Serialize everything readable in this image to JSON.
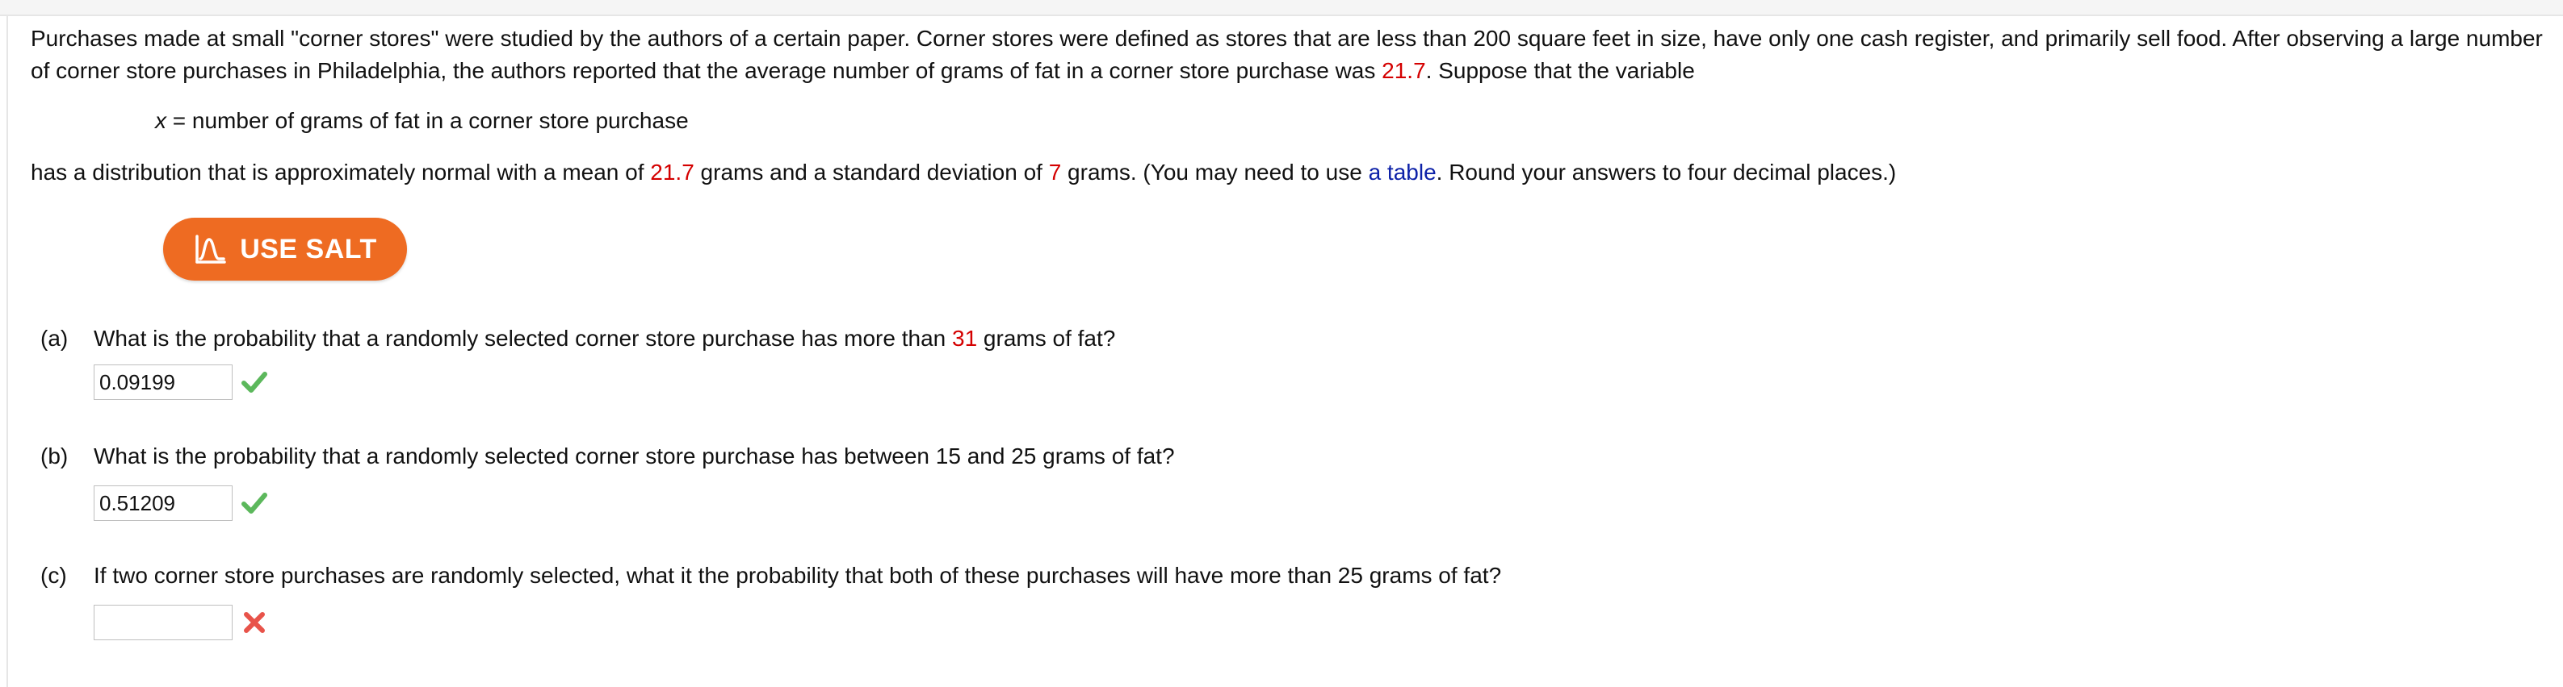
{
  "intro": {
    "part1": "Purchases made at small \"corner stores\" were studied by the authors of a certain paper. Corner stores were defined as stores that are less than 200 square feet in size, have only one cash register, and primarily sell food. After observing a large number of corner store purchases in Philadelphia, the authors reported that the average number of grams of fat in a corner store purchase was ",
    "value": "21.7",
    "part2": ". Suppose that the variable"
  },
  "variable": {
    "symbol": "x",
    "definition": " = number of grams of fat in a corner store purchase"
  },
  "distribution": {
    "part1": "has a distribution that is approximately normal with a mean of ",
    "mean": "21.7",
    "part2": " grams and a standard deviation of ",
    "sd": "7",
    "part3": " grams. (You may need to use ",
    "link": "a table",
    "part4": ". Round your answers to four decimal places.)"
  },
  "salt_button": {
    "label": "USE SALT"
  },
  "questions": [
    {
      "letter": "(a)",
      "text1": "What is the probability that a randomly selected corner store purchase has more than ",
      "highlight": "31",
      "text2": " grams of fat?",
      "answer": "0.09199",
      "status": "correct"
    },
    {
      "letter": "(b)",
      "text1": "What is the probability that a randomly selected corner store purchase has between 15 and 25 grams of fat?",
      "answer": "0.51209",
      "status": "correct"
    },
    {
      "letter": "(c)",
      "text1": "If two corner store purchases are randomly selected, what it the probability that both of these purchases will have more than 25 grams of fat?",
      "answer": "",
      "status": "incorrect"
    }
  ],
  "colors": {
    "highlight_red": "#d40000",
    "link_blue": "#0d21a8",
    "salt_orange": "#ee6b22",
    "check_green": "#5cb85c",
    "cross_red": "#e8534a"
  }
}
